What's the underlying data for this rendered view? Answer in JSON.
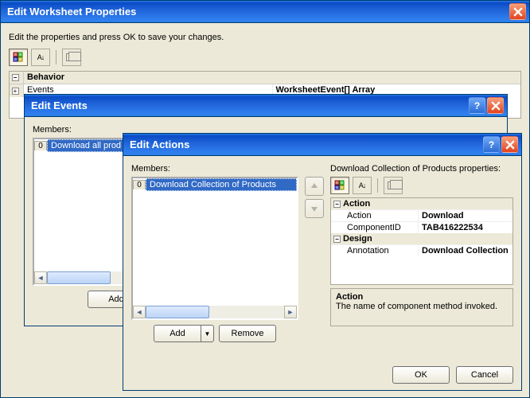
{
  "win1": {
    "title": "Edit Worksheet Properties",
    "instruction": "Edit the properties and press OK to save your changes.",
    "grid": {
      "cat": "Behavior",
      "rowLabel": "Events",
      "rowValue": "WorksheetEvent[] Array"
    }
  },
  "win2": {
    "title": "Edit Events",
    "membersLabel": "Members:",
    "items": [
      "Download all prod"
    ],
    "addLabel": "Add"
  },
  "win3": {
    "title": "Edit Actions",
    "membersLabel": "Members:",
    "items": [
      "Download Collection of Products"
    ],
    "propsHeader": "Download Collection of Products properties:",
    "propgrid": {
      "catAction": "Action",
      "actionLabel": "Action",
      "actionValue": "Download",
      "componentIdLabel": "ComponentID",
      "componentIdValue": "TAB416222534",
      "catDesign": "Design",
      "annotationLabel": "Annotation",
      "annotationValue": "Download Collection"
    },
    "descTitle": "Action",
    "descText": "The name of component method invoked.",
    "addLabel": "Add",
    "removeLabel": "Remove",
    "okLabel": "OK",
    "cancelLabel": "Cancel"
  }
}
